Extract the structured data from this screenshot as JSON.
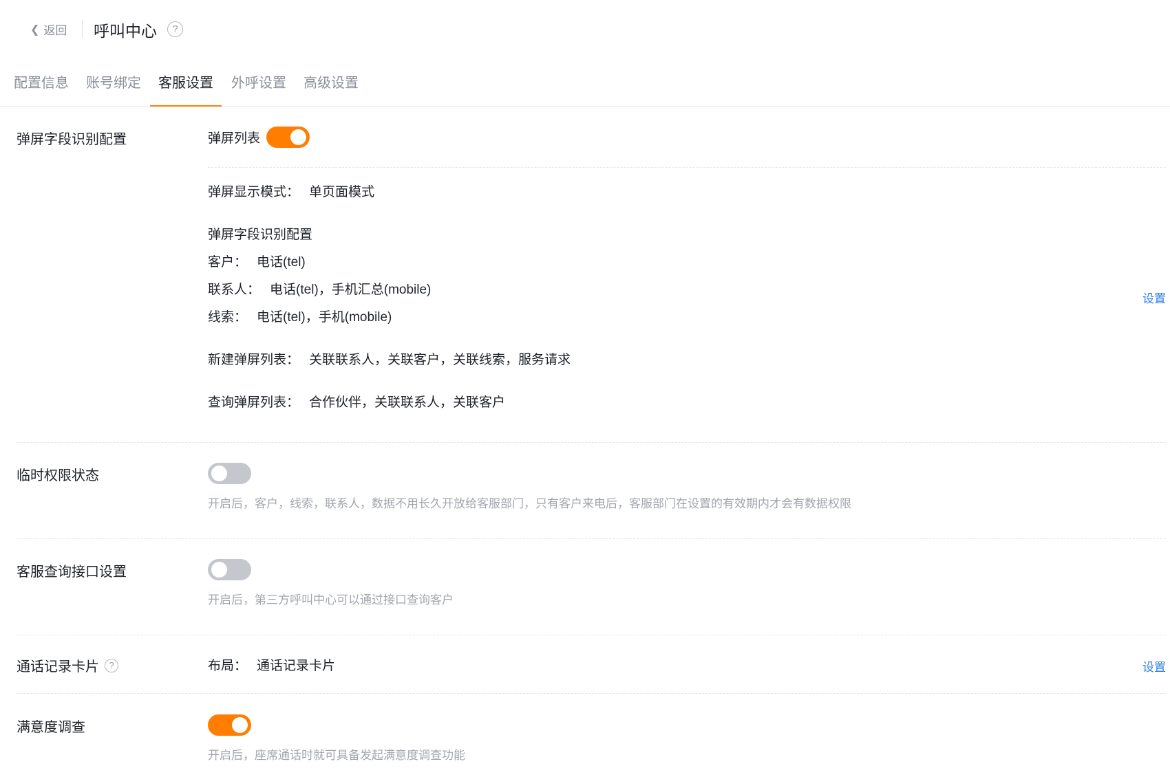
{
  "header": {
    "back_label": "返回",
    "back_icon": "chevron-left-icon",
    "title": "呼叫中心",
    "help_glyph": "?"
  },
  "tabs": [
    {
      "label": "配置信息",
      "active": false
    },
    {
      "label": "账号绑定",
      "active": false
    },
    {
      "label": "客服设置",
      "active": true
    },
    {
      "label": "外呼设置",
      "active": false
    },
    {
      "label": "高级设置",
      "active": false
    }
  ],
  "accent_color": "#ff7d00",
  "link_color": "#2f7fe0",
  "screen_pop": {
    "label": "弹屏字段识别配置",
    "list_toggle_label": "弹屏列表",
    "list_toggle_on": true,
    "display_mode_key": "弹屏显示模式：",
    "display_mode_value": "单页面模式",
    "field_config_title": "弹屏字段识别配置",
    "fields": [
      {
        "key": "客户：",
        "value": "电话(tel)"
      },
      {
        "key": "联系人：",
        "value": "电话(tel)，手机汇总(mobile)"
      },
      {
        "key": "线索：",
        "value": "电话(tel)，手机(mobile)"
      }
    ],
    "new_list_key": "新建弹屏列表：",
    "new_list_value": "关联联系人，关联客户，关联线索，服务请求",
    "query_list_key": "查询弹屏列表：",
    "query_list_value": "合作伙伴，关联联系人，关联客户",
    "settings_link": "设置"
  },
  "temp_permission": {
    "label": "临时权限状态",
    "on": false,
    "hint": "开启后，客户，线索，联系人，数据不用长久开放给客服部门，只有客户来电后，客服部门在设置的有效期内才会有数据权限"
  },
  "query_api": {
    "label": "客服查询接口设置",
    "on": false,
    "hint": "开启后，第三方呼叫中心可以通过接口查询客户"
  },
  "call_record": {
    "label": "通话记录卡片",
    "help_glyph": "?",
    "layout_key": "布局：",
    "layout_value": "通话记录卡片",
    "settings_link": "设置"
  },
  "satisfaction": {
    "label": "满意度调查",
    "on": true,
    "hint": "开启后，座席通话时就可具备发起满意度调查功能"
  }
}
